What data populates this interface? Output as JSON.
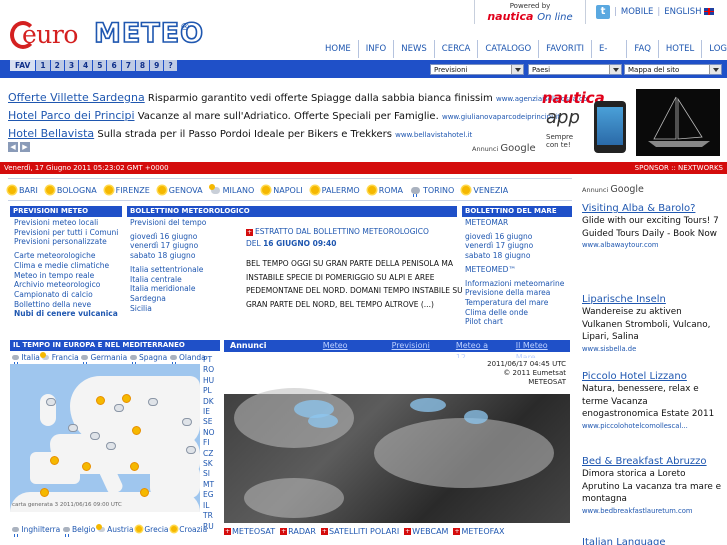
{
  "logo": {
    "euro": "euro",
    "meteo": "METEO",
    "reg": "®"
  },
  "powered": {
    "small": "Powered by",
    "brand": "nautica",
    "tag": "On line"
  },
  "toplinks": {
    "twitter": "t",
    "mobile": "MOBILE",
    "english": "ENGLISH"
  },
  "nav": [
    "HOME",
    "INFO",
    "NEWS",
    "CERCA",
    "CATALOGO",
    "FAVORITI",
    "E-MAIL",
    "FAQ",
    "HOTEL",
    "LOGIN"
  ],
  "fav": [
    "FAV",
    "1",
    "2",
    "3",
    "4",
    "5",
    "6",
    "7",
    "8",
    "9",
    "?"
  ],
  "selects": {
    "previsioni": "Previsioni",
    "paesi": "Paesi",
    "mappa": "Mappa del sito"
  },
  "ads": [
    {
      "title": "Offerte Villette Sardegna",
      "text": "Risparmio garantito vedi offerte Spiagge dalla sabbia bianca finissim",
      "url": "www.agenziaisolarossa.co"
    },
    {
      "title": "Hotel Parco dei Principi",
      "text": "Vacanze al mare sull'Adriatico. Offerte Speciali per Famiglie.",
      "url": "www.giulianovaparcodeiprincipi.it"
    },
    {
      "title": "Hotel Bellavista",
      "text": "Sulla strada per il Passo Pordoi Ideale per Bikers e Trekkers",
      "url": "www.bellavistahotel.it"
    }
  ],
  "ad_nav": {
    "prev": "◀",
    "next": "▶"
  },
  "nautica_ad": {
    "brand": "nautica",
    "app": "app",
    "sempre": "Sempre\ncon te!",
    "annunci": "Annunci",
    "google": "Google"
  },
  "redbar": {
    "date": "Venerdì, 17 Giugno 2011 05:23:02 GMT +0000",
    "sponsor": "SPONSOR :: NEXTWORKS"
  },
  "cities": [
    {
      "name": "BARI",
      "icon": "sun"
    },
    {
      "name": "BOLOGNA",
      "icon": "sun"
    },
    {
      "name": "FIRENZE",
      "icon": "sun"
    },
    {
      "name": "GENOVA",
      "icon": "sun"
    },
    {
      "name": "MILANO",
      "icon": "cloudsun"
    },
    {
      "name": "NAPOLI",
      "icon": "sun"
    },
    {
      "name": "PALERMO",
      "icon": "sun"
    },
    {
      "name": "ROMA",
      "icon": "sun"
    },
    {
      "name": "TORINO",
      "icon": "cloudrain"
    },
    {
      "name": "VENEZIA",
      "icon": "sun"
    }
  ],
  "col1": {
    "head": "PREVISIONI METEO",
    "group1": [
      "Previsioni meteo locali",
      "Previsioni per tutti i Comuni",
      "Previsioni personalizzate"
    ],
    "group2": [
      "Carte meteorologiche",
      "Clima e medie climatiche",
      "Meteo in tempo reale",
      "Archivio meteorologico",
      "Campionato di calcio",
      "Bollettino della neve",
      "Nubi di cenere vulcanica"
    ]
  },
  "col2": {
    "head": "BOLLETTINO METEOROLOGICO",
    "group1": [
      "Previsioni del tempo"
    ],
    "group2": [
      "giovedì 16 giugno",
      "venerdì 17 giugno",
      "sabato 18 giugno"
    ],
    "group3": [
      "Italia settentrionale",
      "Italia centrale",
      "Italia meridionale",
      "Sardegna",
      "Sicilia"
    ]
  },
  "estratto": {
    "link": "ESTRATTO DAL BOLLETTINO METEOROLOGICO",
    "del": "DEL",
    "date": "16 GIUGNO 09:40",
    "body": "BEL TEMPO OGGI SU GRAN PARTE DELLA PENISOLA MA INSTABILE SPECIE DI POMERIGGIO SU ALPI E AREE PEDEMONTANE DEL NORD. DOMANI TEMPO INSTABILE SU GRAN PARTE DEL NORD, BEL TEMPO ALTROVE (...)"
  },
  "col3": {
    "head": "BOLLETTINO DEL MARE",
    "group1": [
      "METEOMAR"
    ],
    "group2": [
      "giovedì 16 giugno",
      "venerdì 17 giugno",
      "sabato 18 giugno"
    ],
    "group3": [
      "METEOMED™"
    ],
    "group4": [
      "Informazioni meteomarine",
      "Previsione della marea",
      "Temperatura del mare",
      "Clima delle onde",
      "Pilot chart"
    ]
  },
  "europe": {
    "head": "IL TEMPO IN EUROPA E NEL MEDITERRANEO",
    "countries_top": [
      "Italia",
      "Francia",
      "Germania",
      "Spagna",
      "Olanda"
    ],
    "countries_bottom": [
      "Inghilterra",
      "Belgio",
      "Austria",
      "Grecia",
      "Croazia"
    ],
    "note": "carta generata 3 2011/06/16 09:00 UTC",
    "codes": [
      "PT",
      "RO",
      "HU",
      "PL",
      "DK",
      "IE",
      "SE",
      "NO",
      "FI",
      "CZ",
      "SK",
      "SI",
      "MT",
      "EG",
      "IL",
      "TR",
      "RU"
    ]
  },
  "sattabs": [
    "Annunci Google",
    "Meteo",
    "Previsioni",
    "Meteo a 12",
    "Il Meteo Mare"
  ],
  "sat": {
    "time": "2011/06/17 04:45 UTC",
    "copy": "© 2011 Eumetsat",
    "name": "METEOSAT"
  },
  "satlinks": [
    "METEOSAT",
    "RADAR",
    "SATELLITI POLARI",
    "WEBCAM",
    "METEOFAX"
  ],
  "right": {
    "annunci": "Annunci",
    "google": "Google",
    "ads": [
      {
        "title": "Visiting Alba & Barolo?",
        "desc": "Glide with our exciting Tours! 7 Guided Tours Daily - Book Now",
        "url": "www.albawaytour.com"
      },
      {
        "title": "Liparische Inseln",
        "desc": "Wandereise zu aktiven Vulkanen Stromboli, Vulcano, Lipari, Salina",
        "url": "www.sisbella.de"
      },
      {
        "title": "Piccolo Hotel Lizzano",
        "desc": "Natura, benessere, relax e terme Vacanza enogastronomica Estate 2011",
        "url": "www.piccolohotelcomollescal..."
      },
      {
        "title": "Bed & Breakfast Abruzzo",
        "desc": "Dimora storica a Loreto Aprutino La vacanza tra mare e montagna",
        "url": "www.bedbreakfastlauretum.com"
      },
      {
        "title": "Italian Language",
        "desc": "",
        "url": ""
      }
    ]
  }
}
